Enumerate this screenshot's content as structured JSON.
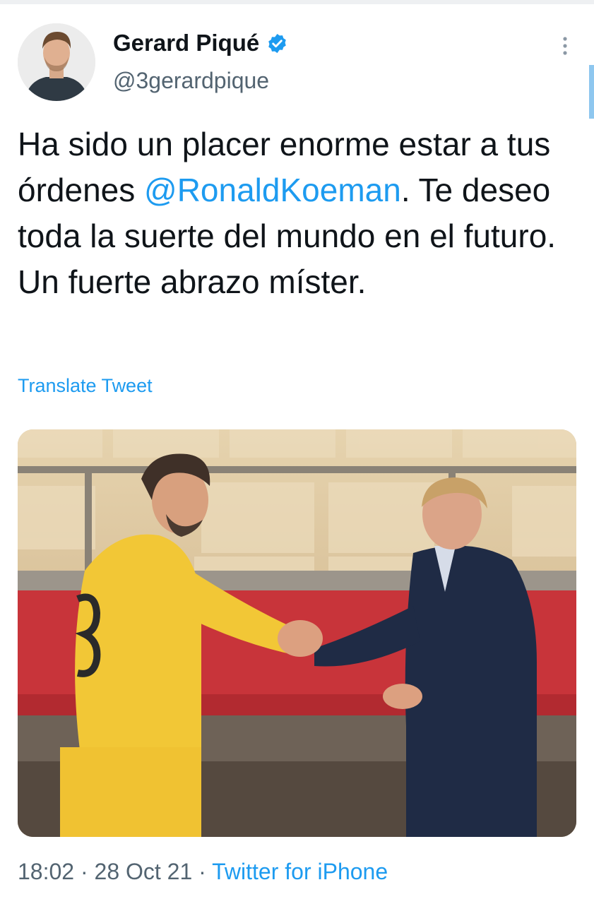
{
  "tweet": {
    "display_name": "Gerard Piqué",
    "handle": "@3gerardpique",
    "text_before": "Ha sido un placer enorme estar a tus órdenes ",
    "mention": "@RonaldKoeman",
    "text_after": ". Te deseo toda la suerte del mundo en el futuro. Un fuerte abrazo míster.",
    "translate_label": "Translate Tweet",
    "time": "18:02",
    "date": "28 Oct 21",
    "separator": " · ",
    "source": "Twitter for iPhone"
  },
  "icons": {
    "verified": "verified-badge-icon",
    "more": "more-vertical-icon"
  },
  "colors": {
    "accent": "#1d9bf0",
    "text": "#0f1419",
    "secondary": "#536471"
  }
}
